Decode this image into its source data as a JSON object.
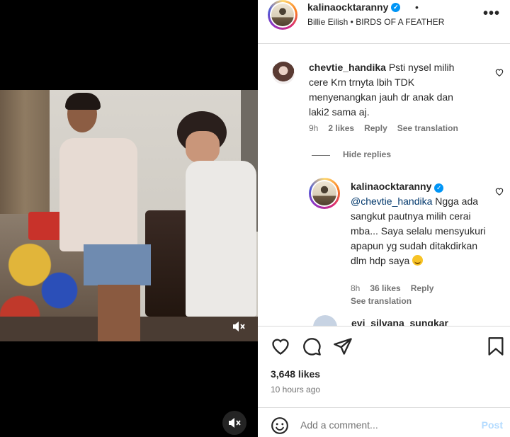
{
  "header": {
    "username": "kalinaocktaranny",
    "separator": "•",
    "audio": "Billie Eilish • BIRDS OF A FEATHER",
    "more_icon": "more-horizontal-icon"
  },
  "comments": [
    {
      "username": "chevtie_handika",
      "text": "Psti nysel milih cere Krn trnyta lbih TDK menyenangkan jauh dr anak dan laki2 sama aj.",
      "time": "9h",
      "likes": "2 likes",
      "reply_label": "Reply",
      "translate_label": "See translation"
    }
  ],
  "hide_replies_label": "Hide replies",
  "reply": {
    "username": "kalinaocktaranny",
    "mention": "@chevtie_handika",
    "text": "Ngga ada sangkut pautnya milih cerai mba... Saya selalu mensyukuri apapun yg sudah ditakdirkan dlm hdp saya",
    "emoji": "smiling-face-emoji",
    "time": "8h",
    "likes": "36 likes",
    "reply_label": "Reply",
    "translate_label": "See translation"
  },
  "next_comment_user": "evi_silvana_sungkar",
  "post": {
    "likes": "3,648 likes",
    "time": "10 hours ago"
  },
  "composer": {
    "placeholder": "Add a comment...",
    "post_label": "Post"
  },
  "colors": {
    "accent_link": "#00376b",
    "verified": "#0095f6",
    "post_disabled": "#b3dbff"
  }
}
